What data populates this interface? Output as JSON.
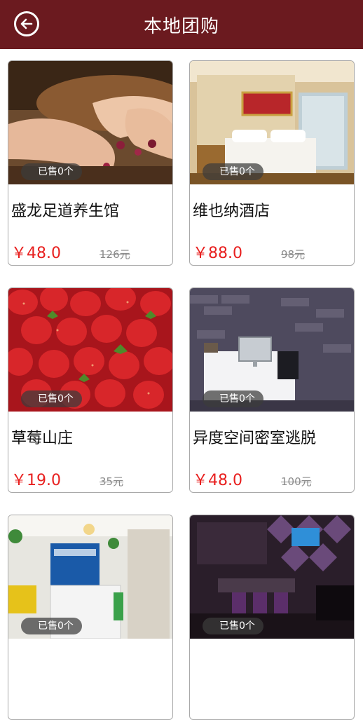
{
  "header": {
    "title": "本地团购",
    "back_icon": "back-arrow-icon",
    "background": "#6b1a1f"
  },
  "colors": {
    "price": "#e8201f",
    "original_price": "#8a8a8a"
  },
  "items": [
    {
      "name": "盛龙足道养生馆",
      "price": "￥48.0",
      "original_price": "126元",
      "sold": "已售0个",
      "image": "foot-massage-photo"
    },
    {
      "name": "维也纳酒店",
      "price": "￥88.0",
      "original_price": "98元",
      "sold": "已售0个",
      "image": "hotel-room-photo"
    },
    {
      "name": "草莓山庄",
      "price": "￥19.0",
      "original_price": "35元",
      "sold": "已售0个",
      "image": "strawberries-photo"
    },
    {
      "name": "异度空间密室逃脱",
      "price": "￥48.0",
      "original_price": "100元",
      "sold": "已售0个",
      "image": "escape-room-photo"
    },
    {
      "name": "",
      "price": "",
      "original_price": "",
      "sold": "已售0个",
      "image": "salon-reception-photo"
    },
    {
      "name": "",
      "price": "",
      "original_price": "",
      "sold": "已售0个",
      "image": "ktv-lounge-photo"
    }
  ]
}
